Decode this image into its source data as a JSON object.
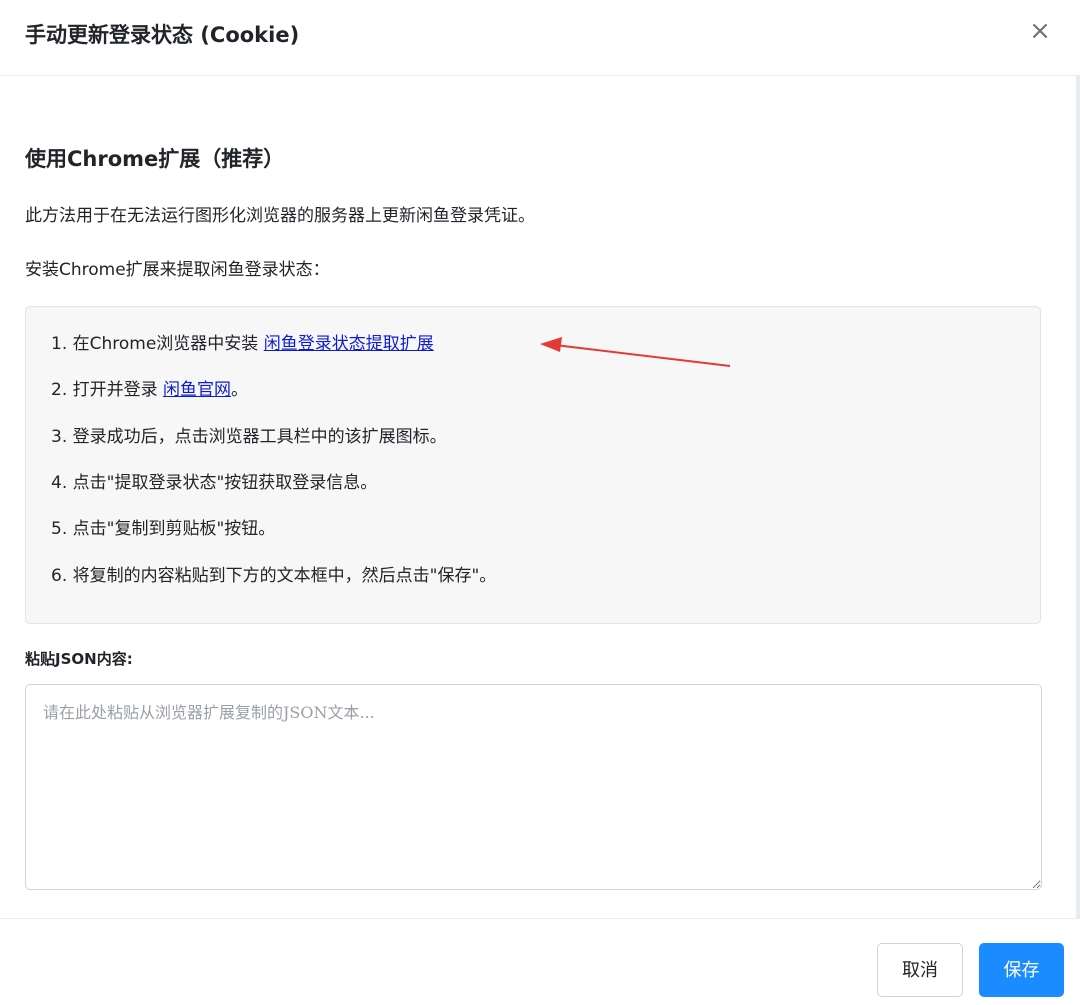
{
  "dialog": {
    "title": "手动更新登录状态 (Cookie)",
    "close_label": "×"
  },
  "content": {
    "heading": "使用Chrome扩展（推荐）",
    "intro": "此方法用于在无法运行图形化浏览器的服务器上更新闲鱼登录凭证。",
    "install_prompt": "安装Chrome扩展来提取闲鱼登录状态：",
    "steps": [
      {
        "prefix": "1. 在Chrome浏览器中安装 ",
        "link": "闲鱼登录状态提取扩展",
        "suffix": ""
      },
      {
        "prefix": "2. 打开并登录 ",
        "link": "闲鱼官网",
        "suffix": "。"
      },
      {
        "prefix": "3. 登录成功后，点击浏览器工具栏中的该扩展图标。"
      },
      {
        "prefix": "4. 点击\"提取登录状态\"按钮获取登录信息。"
      },
      {
        "prefix": "5. 点击\"复制到剪贴板\"按钮。"
      },
      {
        "prefix": "6. 将复制的内容粘贴到下方的文本框中，然后点击\"保存\"。"
      }
    ],
    "json_field": {
      "label": "粘贴JSON内容:",
      "value": "",
      "placeholder": "请在此处粘贴从浏览器扩展复制的JSON文本..."
    }
  },
  "footer": {
    "cancel_label": "取消",
    "save_label": "保存"
  },
  "colors": {
    "primary": "#1a8cff",
    "link": "#0d1bd6",
    "annotation_arrow": "#e53935",
    "steps_background": "#f7f7f7"
  },
  "icons": {
    "close": "close-icon",
    "resize": "resize-handle-icon"
  }
}
